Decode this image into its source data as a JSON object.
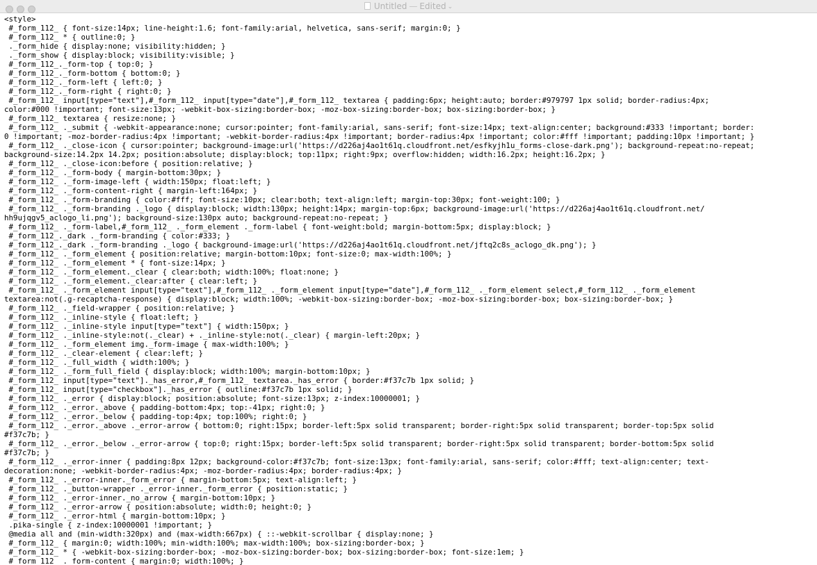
{
  "window": {
    "title": "Untitled",
    "separator": "—",
    "status": "Edited",
    "chevron": "⌄",
    "document_icon": "document-icon"
  },
  "editor": {
    "lines": [
      "<style>",
      " #_form_112_ { font-size:14px; line-height:1.6; font-family:arial, helvetica, sans-serif; margin:0; }",
      " #_form_112_ * { outline:0; }",
      " ._form_hide { display:none; visibility:hidden; }",
      " ._form_show { display:block; visibility:visible; }",
      " #_form_112_._form-top { top:0; }",
      " #_form_112_._form-bottom { bottom:0; }",
      " #_form_112_._form-left { left:0; }",
      " #_form_112_._form-right { right:0; }",
      " #_form_112_ input[type=\"text\"],#_form_112_ input[type=\"date\"],#_form_112_ textarea { padding:6px; height:auto; border:#979797 1px solid; border-radius:4px;",
      "color:#000 !important; font-size:13px; -webkit-box-sizing:border-box; -moz-box-sizing:border-box; box-sizing:border-box; }",
      " #_form_112_ textarea { resize:none; }",
      " #_form_112_ ._submit { -webkit-appearance:none; cursor:pointer; font-family:arial, sans-serif; font-size:14px; text-align:center; background:#333 !important; border:",
      "0 !important; -moz-border-radius:4px !important; -webkit-border-radius:4px !important; border-radius:4px !important; color:#fff !important; padding:10px !important; }",
      " #_form_112_ ._close-icon { cursor:pointer; background-image:url('https://d226aj4ao1t61q.cloudfront.net/esfkyjh1u_forms-close-dark.png'); background-repeat:no-repeat;",
      "background-size:14.2px 14.2px; position:absolute; display:block; top:11px; right:9px; overflow:hidden; width:16.2px; height:16.2px; }",
      " #_form_112_ ._close-icon:before { position:relative; }",
      " #_form_112_ ._form-body { margin-bottom:30px; }",
      " #_form_112_ ._form-image-left { width:150px; float:left; }",
      " #_form_112_ ._form-content-right { margin-left:164px; }",
      " #_form_112_ ._form-branding { color:#fff; font-size:10px; clear:both; text-align:left; margin-top:30px; font-weight:100; }",
      " #_form_112_ ._form-branding ._logo { display:block; width:130px; height:14px; margin-top:6px; background-image:url('https://d226aj4ao1t61q.cloudfront.net/",
      "hh9ujqgv5_aclogo_li.png'); background-size:130px auto; background-repeat:no-repeat; }",
      " #_form_112_ ._form-label,#_form_112_ ._form_element ._form-label { font-weight:bold; margin-bottom:5px; display:block; }",
      " #_form_112_._dark ._form-branding { color:#333; }",
      " #_form_112_._dark ._form-branding ._logo { background-image:url('https://d226aj4ao1t61q.cloudfront.net/jftq2c8s_aclogo_dk.png'); }",
      " #_form_112_ ._form_element { position:relative; margin-bottom:10px; font-size:0; max-width:100%; }",
      " #_form_112_ ._form_element * { font-size:14px; }",
      " #_form_112_ ._form_element._clear { clear:both; width:100%; float:none; }",
      " #_form_112_ ._form_element._clear:after { clear:left; }",
      " #_form_112_ ._form_element input[type=\"text\"],#_form_112_ ._form_element input[type=\"date\"],#_form_112_ ._form_element select,#_form_112_ ._form_element",
      "textarea:not(.g-recaptcha-response) { display:block; width:100%; -webkit-box-sizing:border-box; -moz-box-sizing:border-box; box-sizing:border-box; }",
      " #_form_112_ ._field-wrapper { position:relative; }",
      " #_form_112_ ._inline-style { float:left; }",
      " #_form_112_ ._inline-style input[type=\"text\"] { width:150px; }",
      " #_form_112_ ._inline-style:not(._clear) + ._inline-style:not(._clear) { margin-left:20px; }",
      " #_form_112_ ._form_element img._form-image { max-width:100%; }",
      " #_form_112_ ._clear-element { clear:left; }",
      " #_form_112_ ._full_width { width:100%; }",
      " #_form_112_ ._form_full_field { display:block; width:100%; margin-bottom:10px; }",
      " #_form_112_ input[type=\"text\"]._has_error,#_form_112_ textarea._has_error { border:#f37c7b 1px solid; }",
      " #_form_112_ input[type=\"checkbox\"]._has_error { outline:#f37c7b 1px solid; }",
      " #_form_112_ ._error { display:block; position:absolute; font-size:13px; z-index:10000001; }",
      " #_form_112_ ._error._above { padding-bottom:4px; top:-41px; right:0; }",
      " #_form_112_ ._error._below { padding-top:4px; top:100%; right:0; }",
      " #_form_112_ ._error._above ._error-arrow { bottom:0; right:15px; border-left:5px solid transparent; border-right:5px solid transparent; border-top:5px solid",
      "#f37c7b; }",
      " #_form_112_ ._error._below ._error-arrow { top:0; right:15px; border-left:5px solid transparent; border-right:5px solid transparent; border-bottom:5px solid",
      "#f37c7b; }",
      " #_form_112_ ._error-inner { padding:8px 12px; background-color:#f37c7b; font-size:13px; font-family:arial, sans-serif; color:#fff; text-align:center; text-",
      "decoration:none; -webkit-border-radius:4px; -moz-border-radius:4px; border-radius:4px; }",
      " #_form_112_ ._error-inner._form_error { margin-bottom:5px; text-align:left; }",
      " #_form_112_ ._button-wrapper ._error-inner._form_error { position:static; }",
      " #_form_112_ ._error-inner._no_arrow { margin-bottom:10px; }",
      " #_form_112_ ._error-arrow { position:absolute; width:0; height:0; }",
      " #_form_112_ ._error-html { margin-bottom:10px; }",
      " .pika-single { z-index:10000001 !important; }",
      " @media all and (min-width:320px) and (max-width:667px) { ::-webkit-scrollbar { display:none; }",
      " #_form_112_ { margin:0; width:100%; min-width:100%; max-width:100%; box-sizing:border-box; }",
      " #_form_112_ * { -webkit-box-sizing:border-box; -moz-box-sizing:border-box; box-sizing:border-box; font-size:1em; }",
      " #_form_112_ ._form-content { margin:0; width:100%; }"
    ]
  }
}
